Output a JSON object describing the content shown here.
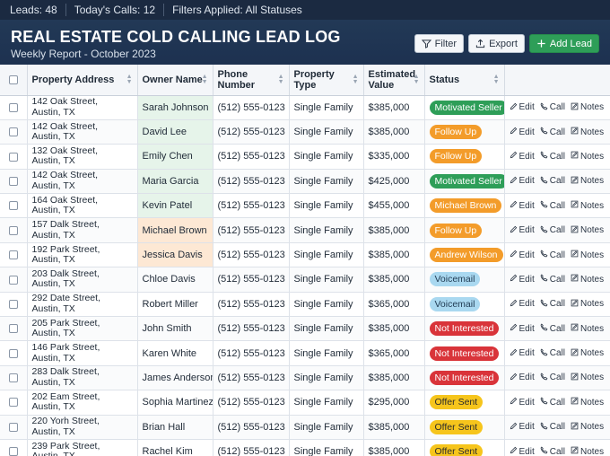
{
  "topbar": {
    "leads": "Leads: 48",
    "calls": "Today's Calls: 12",
    "filters": "Filters Applied: All Statuses"
  },
  "header": {
    "title": "REAL ESTATE COLD CALLING LEAD LOG",
    "subtitle": "Weekly Report - October 2023",
    "filter_label": "Filter",
    "export_label": "Export",
    "add_label": "Add Lead"
  },
  "columns": {
    "address": "Property Address",
    "owner": "Owner Name",
    "phone": "Phone Number",
    "type": "Property Type",
    "value": "Estimated Value",
    "status": "Status"
  },
  "row_actions": {
    "edit": "Edit",
    "call": "Call",
    "notes": "Notes"
  },
  "status_colors": {
    "Motivated Seller": {
      "bg": "#2e9e58",
      "fg": "#ffffff"
    },
    "Follow Up": {
      "bg": "#f39c2a",
      "fg": "#ffffff"
    },
    "Michael Brown": {
      "bg": "#f39c2a",
      "fg": "#ffffff"
    },
    "Andrew Wilson": {
      "bg": "#f39c2a",
      "fg": "#ffffff"
    },
    "Voicemail": {
      "bg": "#a9d8f0",
      "fg": "#1f3a52"
    },
    "Not Interested": {
      "bg": "#d9343a",
      "fg": "#ffffff"
    },
    "Offer Sent": {
      "bg": "#f6c51c",
      "fg": "#2b2b2b"
    }
  },
  "rows": [
    {
      "addr1": "142 Oak Street,",
      "addr2": "Austin, TX",
      "owner": "Sarah Johnson",
      "owner_hl": "green",
      "phone": "(512) 555-0123",
      "type": "Single Family",
      "value": "$385,000",
      "status": "Motivated Seller"
    },
    {
      "addr1": "142 Oak Street,",
      "addr2": "Austin, TX",
      "owner": "David Lee",
      "owner_hl": "green",
      "phone": "(512) 555-0123",
      "type": "Single Family",
      "value": "$385,000",
      "status": "Follow Up"
    },
    {
      "addr1": "132 Oak Street,",
      "addr2": "Austin, TX",
      "owner": "Emily Chen",
      "owner_hl": "green",
      "phone": "(512) 555-0123",
      "type": "Single Family",
      "value": "$335,000",
      "status": "Follow Up"
    },
    {
      "addr1": "142 Oak Street,",
      "addr2": "Austin, TX",
      "owner": "Maria Garcia",
      "owner_hl": "green",
      "phone": "(512) 555-0123",
      "type": "Single Family",
      "value": "$425,000",
      "status": "Motivated Seller"
    },
    {
      "addr1": "164 Oak Street,",
      "addr2": "Austin, TX",
      "owner": "Kevin Patel",
      "owner_hl": "green",
      "phone": "(512) 555-0123",
      "type": "Single Family",
      "value": "$455,000",
      "status": "Michael Brown"
    },
    {
      "addr1": "157 Dalk Street,",
      "addr2": "Austin, TX",
      "owner": "Michael Brown",
      "owner_hl": "orange",
      "phone": "(512) 555-0123",
      "type": "Single Family",
      "value": "$385,000",
      "status": "Follow Up"
    },
    {
      "addr1": "192 Park Street,",
      "addr2": "Austin, TX",
      "owner": "Jessica Davis",
      "owner_hl": "orange",
      "phone": "(512) 555-0123",
      "type": "Single Family",
      "value": "$385,000",
      "status": "Andrew Wilson"
    },
    {
      "addr1": "203 Dalk Street,",
      "addr2": "Austin, TX",
      "owner": "Chloe Davis",
      "owner_hl": "",
      "phone": "(512) 555-0123",
      "type": "Single Family",
      "value": "$385,000",
      "status": "Voicemail"
    },
    {
      "addr1": "292 Date Street,",
      "addr2": "Austin, TX",
      "owner": "Robert Miller",
      "owner_hl": "",
      "phone": "(512) 555-0123",
      "type": "Single Family",
      "value": "$365,000",
      "status": "Voicemail"
    },
    {
      "addr1": "205 Park Street,",
      "addr2": "Austin, TX",
      "owner": "John Smith",
      "owner_hl": "",
      "phone": "(512) 555-0123",
      "type": "Single Family",
      "value": "$385,000",
      "status": "Not Interested"
    },
    {
      "addr1": "146 Park Street,",
      "addr2": "Austin, TX",
      "owner": "Karen White",
      "owner_hl": "",
      "phone": "(512) 555-0123",
      "type": "Single Family",
      "value": "$365,000",
      "status": "Not Interested"
    },
    {
      "addr1": "283 Dalk Street,",
      "addr2": "Austin, TX",
      "owner": "James Anderson",
      "owner_hl": "",
      "phone": "(512) 555-0123",
      "type": "Single Family",
      "value": "$385,000",
      "status": "Not Interested"
    },
    {
      "addr1": "202 Eam Street,",
      "addr2": "Austin, TX",
      "owner": "Sophia Martinez",
      "owner_hl": "",
      "phone": "(512) 555-0123",
      "type": "Single Family",
      "value": "$295,000",
      "status": "Offer Sent"
    },
    {
      "addr1": "220 Yorh Street,",
      "addr2": "Austin, TX",
      "owner": "Brian Hall",
      "owner_hl": "",
      "phone": "(512) 555-0123",
      "type": "Single Family",
      "value": "$385,000",
      "status": "Offer Sent"
    },
    {
      "addr1": "239 Park Street,",
      "addr2": "Austin, TX",
      "owner": "Rachel Kim",
      "owner_hl": "",
      "phone": "(512) 555-0123",
      "type": "Single Family",
      "value": "$385,000",
      "status": "Offer Sent"
    }
  ]
}
